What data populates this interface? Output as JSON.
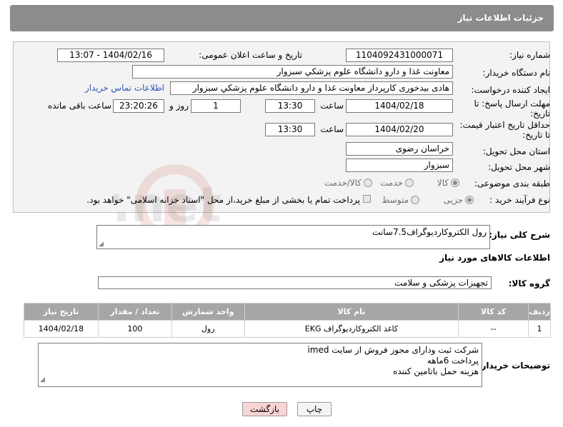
{
  "header": {
    "title": "جزئیات اطلاعات نیاز"
  },
  "fields": {
    "need_number_label": "شماره نیاز:",
    "need_number": "1104092431000071",
    "announce_label": "تاریخ و ساعت اعلان عمومی:",
    "announce_value": "1404/02/16 - 13:07",
    "buyer_label": "نام دستگاه خریدار:",
    "buyer_value": "معاونت غذا و دارو   دانشگاه علوم پزشکي سبزوار",
    "creator_label": "ایجاد کننده درخواست:",
    "creator_value": "هادی بیدخوری کارپرداز معاونت غذا و دارو   دانشگاه علوم پزشکي سبزوار",
    "contact_link": "اطلاعات تماس خریدار",
    "deadline_label_1": "مهلت ارسال پاسخ: تا",
    "deadline_label_2": "تاریخ:",
    "deadline_date": "1404/02/18",
    "time_label": "ساعت",
    "deadline_time": "13:30",
    "days_value": "1",
    "days_label": "روز و",
    "remaining_value": "23:20:26",
    "remaining_label": "ساعت باقی مانده",
    "validity_label_1": "حداقل تاریخ اعتبار قیمت:",
    "validity_label_2": "تا تاریخ:",
    "validity_date": "1404/02/20",
    "validity_time": "13:30",
    "province_label": "استان محل تحویل:",
    "province_value": "خراسان رضوی",
    "city_label": "شهر محل تحویل:",
    "city_value": "سبزوار",
    "category_label": "طبقه بندی موضوعی:",
    "category_options": [
      "کالا",
      "خدمت",
      "کالا/خدمت"
    ],
    "category_selected": "کالا",
    "process_label": "نوع فرآیند خرید :",
    "process_options": [
      "جزیی",
      "متوسط"
    ],
    "process_selected": "جزیی",
    "payment_note": "پرداخت تمام یا بخشی از مبلغ خرید،از محل \"اسناد خزانه اسلامی\" خواهد بود."
  },
  "description": {
    "label": "شرح کلی نیاز:",
    "value": "رول الکتروکاردیوگراف7.5سانت"
  },
  "goods_section": {
    "title": "اطلاعات کالاهای مورد نیاز",
    "group_label": "گروه کالا:",
    "group_value": "تجهیزات پزشکی و سلامت"
  },
  "table": {
    "headers": [
      "ردیف",
      "کد کالا",
      "نام کالا",
      "واحد شمارش",
      "تعداد / مقدار",
      "تاریخ نیاز"
    ],
    "rows": [
      [
        "1",
        "--",
        "کاغذ الکتروکاردیوگراف EKG",
        "رول",
        "100",
        "1404/02/18"
      ]
    ]
  },
  "buyer_notes": {
    "label": "توضیحات خریدار:",
    "lines": [
      "شرکت ثبت ودارای مجوز فروش از سایت imed",
      "پرداخت 6ماهه",
      "هزینه حمل باتامین کننده"
    ]
  },
  "buttons": {
    "print": "چاپ",
    "back": "بازگشت"
  },
  "watermark": {
    "text": "AriaTender.net"
  },
  "colors": {
    "header_bg": "#8c8c8c",
    "link": "#2f57b5",
    "table_header_bg": "#a6a6a6",
    "back_button_bg": "#f8d4d4"
  }
}
